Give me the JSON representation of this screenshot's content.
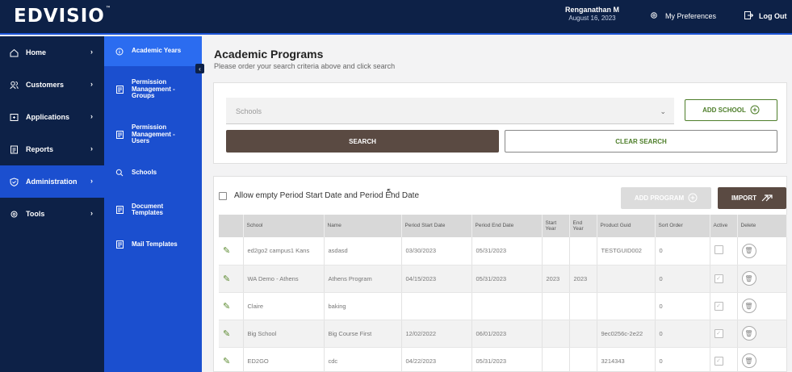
{
  "header": {
    "logo": "EDVISIO",
    "logo_tm": "™",
    "user_name": "Renganathan M",
    "user_date": "August 16, 2023",
    "preferences_label": "My Preferences",
    "logout_label": "Log Out"
  },
  "nav": {
    "items": [
      {
        "label": "Home",
        "icon": "home-icon"
      },
      {
        "label": "Customers",
        "icon": "customers-icon"
      },
      {
        "label": "Applications",
        "icon": "applications-icon"
      },
      {
        "label": "Reports",
        "icon": "reports-icon"
      },
      {
        "label": "Administration",
        "icon": "shield-icon",
        "active": true
      },
      {
        "label": "Tools",
        "icon": "gear-icon"
      }
    ]
  },
  "subnav": {
    "items": [
      {
        "label": "Academic Years",
        "icon": "info-icon",
        "active": true
      },
      {
        "label": "Permission Management - Groups",
        "icon": "document-icon"
      },
      {
        "label": "Permission Management - Users",
        "icon": "document-icon"
      },
      {
        "label": "Schools",
        "icon": "school-icon"
      },
      {
        "label": "Document Templates",
        "icon": "document-icon"
      },
      {
        "label": "Mail Templates",
        "icon": "document-icon"
      }
    ]
  },
  "main": {
    "title": "Academic Programs",
    "subtitle": "Please order your search criteria above and click search",
    "school_placeholder": "Schools",
    "add_school_label": "ADD SCHOOL",
    "search_label": "SEARCH",
    "clear_label": "CLEAR SEARCH",
    "allow_empty_label": "Allow empty Period Start Date and Period End Date",
    "add_program_label": "ADD PROGRAM",
    "import_label": "IMPORT"
  },
  "table": {
    "columns": [
      "",
      "School",
      "Name",
      "Period Start Date",
      "Period End Date",
      "Start Year",
      "End Year",
      "Product Guid",
      "Sort Order",
      "Active",
      "Delete"
    ],
    "rows": [
      {
        "school": "ed2go2 campus1 Kans",
        "name": "asdasd",
        "start": "03/30/2023",
        "end": "05/31/2023",
        "start_year": "",
        "end_year": "",
        "guid": "TESTGUID002",
        "sort": "0",
        "active": false
      },
      {
        "school": "WA Demo - Athens",
        "name": "Athens Program",
        "start": "04/15/2023",
        "end": "05/31/2023",
        "start_year": "2023",
        "end_year": "2023",
        "guid": "",
        "sort": "0",
        "active": true
      },
      {
        "school": "Claire",
        "name": "baking",
        "start": "",
        "end": "",
        "start_year": "",
        "end_year": "",
        "guid": "",
        "sort": "0",
        "active": true
      },
      {
        "school": "Big School",
        "name": "Big Course First",
        "start": "12/02/2022",
        "end": "06/01/2023",
        "start_year": "",
        "end_year": "",
        "guid": "9ec0256c-2e22",
        "sort": "0",
        "active": true
      },
      {
        "school": "ED2GO",
        "name": "cdc",
        "start": "04/22/2023",
        "end": "05/31/2023",
        "start_year": "",
        "end_year": "",
        "guid": "3214343",
        "sort": "0",
        "active": true
      }
    ]
  }
}
